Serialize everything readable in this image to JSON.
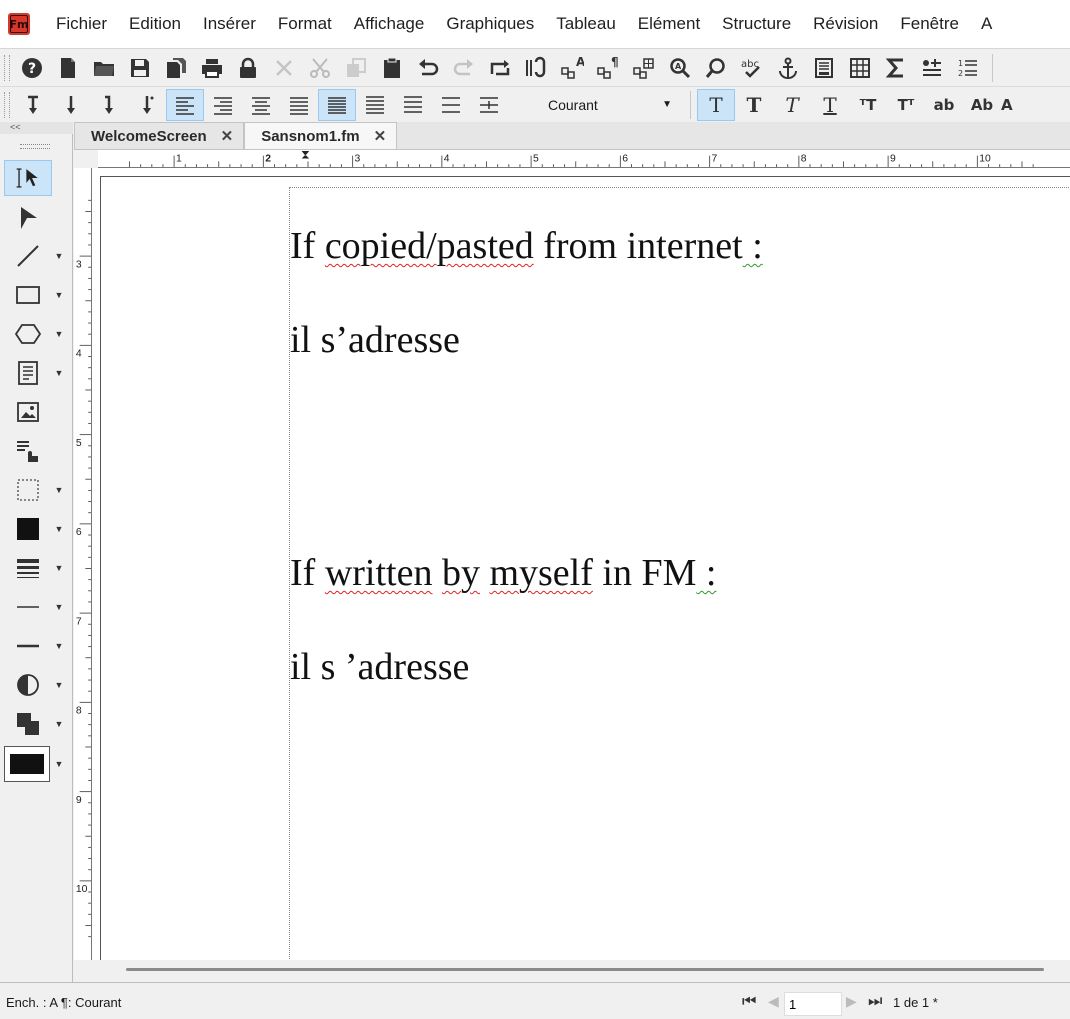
{
  "app": {
    "logo_text": "Fm"
  },
  "menu": [
    "Fichier",
    "Edition",
    "Insérer",
    "Format",
    "Affichage",
    "Graphiques",
    "Tableau",
    "Elément",
    "Structure",
    "Révision",
    "Fenêtre",
    "A"
  ],
  "toolbar2": {
    "paragraph_format": "Courant",
    "char_buttons": [
      "T",
      "T",
      "T",
      "T",
      "ᵀT",
      "Tᵀ",
      "ab",
      "Ab",
      "A"
    ]
  },
  "tabs": [
    {
      "label": "WelcomeScreen",
      "close": "✕"
    },
    {
      "label": "Sansnom1.fm",
      "close": "✕"
    }
  ],
  "ruler": {
    "h_labels": [
      "1",
      "2",
      "3",
      "4",
      "5",
      "6",
      "7",
      "8",
      "9",
      "10"
    ],
    "v_labels": [
      "3",
      "4",
      "5",
      "6",
      "7",
      "8",
      "9",
      "10"
    ]
  },
  "document": {
    "line1_a": "If ",
    "line1_b": "copied/pasted",
    "line1_c": " from internet",
    "line1_d": " :",
    "line2": "il s’adresse",
    "line3_a": "If ",
    "line3_b": "written",
    "line3_c": " ",
    "line3_d": "by",
    "line3_e": " ",
    "line3_f": "myself",
    "line3_g": " in FM",
    "line3_h": " :",
    "line4": "il s ’adresse"
  },
  "status": {
    "text": "Ench. : A  ¶: Courant",
    "first": "⏮",
    "prev": "◀",
    "page_input": "1",
    "next": "▶",
    "last": "⏭",
    "page_count": "1 de 1 *"
  },
  "colors": {
    "logo_bg": "#d8372b",
    "active_bg": "#cce4f7",
    "spell_red": "#d22222",
    "grammar_green": "#2a9a2a"
  }
}
